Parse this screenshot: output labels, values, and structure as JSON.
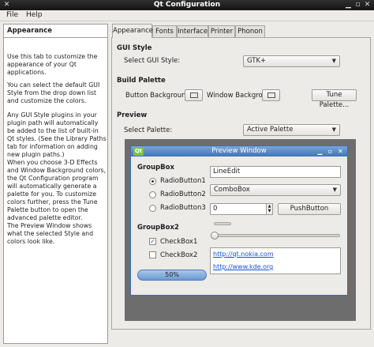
{
  "window": {
    "title": "Qt Configuration"
  },
  "menu": {
    "file": "File",
    "help": "Help"
  },
  "help_panel": {
    "title": "Appearance",
    "paragraphs": [
      "Use this tab to customize the appearance of your Qt applications.",
      "You can select the default GUI Style from the drop down list and customize the colors.",
      "Any GUI Style plugins in your plugin path will automatically be added to the list of built-in Qt styles. (See the Library Paths tab for information on adding new plugin paths.)",
      "When you choose 3-D Effects and Window Background colors, the Qt Configuration program will automatically generate a palette for you. To customize colors further, press the Tune Palette button to open the advanced palette editor.",
      "The Preview Window shows what the selected Style and colors look like."
    ]
  },
  "tabs": [
    "Appearance",
    "Fonts",
    "Interface",
    "Printer",
    "Phonon"
  ],
  "gui_style": {
    "section": "GUI Style",
    "label": "Select GUI Style:",
    "value": "GTK+"
  },
  "build_palette": {
    "section": "Build Palette",
    "button_bg_label": "Button Background:",
    "window_bg_label": "Window Backgrou",
    "tune_button": "Tune Palette..."
  },
  "preview": {
    "section": "Preview",
    "label": "Select Palette:",
    "value": "Active Palette"
  },
  "preview_window": {
    "title": "Preview Window",
    "logo": "Qt",
    "groupbox1": "GroupBox",
    "radios": [
      "RadioButton1",
      "RadioButton2",
      "RadioButton3"
    ],
    "lineedit": "LineEdit",
    "combobox": "ComboBox",
    "spinbox": "0",
    "pushbutton": "PushButton",
    "groupbox2": "GroupBox2",
    "checkboxes": [
      "CheckBox1",
      "CheckBox2"
    ],
    "links": [
      "http://qt.nokia.com",
      "http://www.kde.org"
    ],
    "progress_text": "50%",
    "progress_value": 50
  }
}
